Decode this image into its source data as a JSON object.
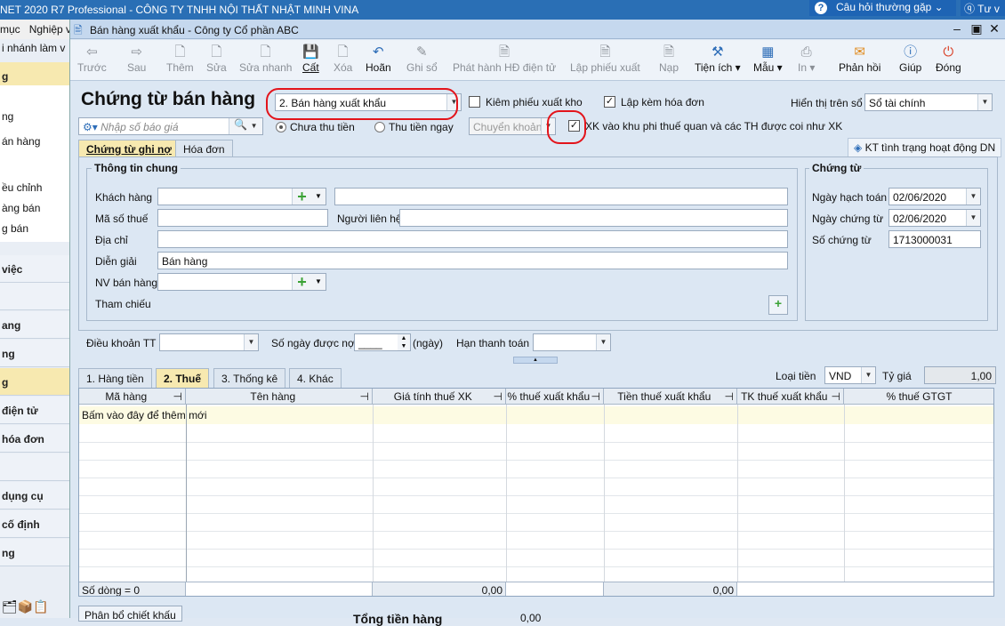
{
  "app": {
    "title": "NET 2020 R7 Professional - CÔNG TY TNHH NỘI THẤT NHẬT MINH VINA",
    "faq_label": "Câu hỏi thường gặp",
    "help_label": "Tư v",
    "menu": [
      "mục",
      "Nghiệp v"
    ]
  },
  "sidebar": {
    "items": [
      {
        "label": "i nhánh làm v",
        "kind": "text"
      },
      {
        "label": "g",
        "kind": "head"
      },
      {
        "label": "ng",
        "kind": "text"
      },
      {
        "label": "án hàng",
        "kind": "text"
      },
      {
        "label": "ều chỉnh",
        "kind": "text"
      },
      {
        "label": "àng bán",
        "kind": "text"
      },
      {
        "label": "g bán",
        "kind": "text"
      },
      {
        "label": "việc",
        "kind": "head"
      },
      {
        "label": "ang",
        "kind": "head"
      },
      {
        "label": "ng",
        "kind": "head"
      },
      {
        "label": "g",
        "kind": "head"
      },
      {
        "label": "điện tử",
        "kind": "head"
      },
      {
        "label": "hóa đơn",
        "kind": "head"
      },
      {
        "label": "dụng cụ",
        "kind": "head"
      },
      {
        "label": "cố định",
        "kind": "head"
      },
      {
        "label": "ng",
        "kind": "head"
      }
    ]
  },
  "dialog": {
    "title": "Bán hàng xuất khẩu - Công ty Cổ phần ABC"
  },
  "toolbar": {
    "items": [
      {
        "label": "Trước",
        "icon": "arrow-left-icon",
        "enabled": false
      },
      {
        "label": "Sau",
        "icon": "arrow-right-icon",
        "enabled": false
      },
      {
        "label": "Thêm",
        "icon": "new-document-icon",
        "enabled": false
      },
      {
        "label": "Sửa",
        "icon": "edit-document-icon",
        "enabled": false
      },
      {
        "label": "Sửa nhanh",
        "icon": "quick-edit-icon",
        "enabled": false
      },
      {
        "label": "Cất",
        "icon": "save-icon",
        "enabled": true
      },
      {
        "label": "Xóa",
        "icon": "delete-icon",
        "enabled": false
      },
      {
        "label": "Hoãn",
        "icon": "undo-icon",
        "enabled": true
      },
      {
        "label": "Ghi sổ",
        "icon": "pencil-icon",
        "enabled": false
      },
      {
        "label": "Phát hành HĐ điện tử",
        "icon": "e-invoice-icon",
        "enabled": false
      },
      {
        "label": "Lập phiếu xuất",
        "icon": "issue-slip-icon",
        "enabled": false
      },
      {
        "label": "Nạp",
        "icon": "load-icon",
        "enabled": false
      },
      {
        "label": "Tiện ích",
        "icon": "tools-icon",
        "enabled": true
      },
      {
        "label": "Mẫu",
        "icon": "template-icon",
        "enabled": true
      },
      {
        "label": "In",
        "icon": "print-icon",
        "enabled": false
      },
      {
        "label": "Phản hồi",
        "icon": "feedback-mail-icon",
        "enabled": true
      },
      {
        "label": "Giúp",
        "icon": "help-icon",
        "enabled": true
      },
      {
        "label": "Đóng",
        "icon": "close-power-icon",
        "enabled": true
      }
    ]
  },
  "header": {
    "title": "Chứng từ bán hàng",
    "sale_type": "2. Bán hàng xuất khẩu",
    "kiem_phieu_xuat_kho": "Kiêm phiếu xuất kho",
    "lap_kem_hoa_don": "Lập kèm hóa đơn",
    "hien_thi_label": "Hiển thị trên sổ",
    "hien_thi_value": "Sổ tài chính",
    "quote_placeholder": "Nhập số báo giá",
    "chua_thu_tien": "Chưa thu tiền",
    "thu_tien_ngay": "Thu tiền ngay",
    "payment_method": "Chuyển khoản",
    "xk_label": "XK vào khu phi thuế quan và các TH được coi như XK",
    "kt_label": "KT tình trạng hoạt động DN"
  },
  "tabs": [
    "Chứng từ ghi nợ",
    "Hóa đơn"
  ],
  "general": {
    "title": "Thông tin chung",
    "khach_hang": "Khách hàng",
    "ma_so_thue": "Mã số thuế",
    "nguoi_lien_he": "Người liên hệ",
    "dia_chi": "Địa chỉ",
    "dien_giai": "Diễn giải",
    "dien_giai_value": "Bán hàng",
    "nv_ban_hang": "NV bán hàng",
    "tham_chieu": "Tham chiếu"
  },
  "voucher": {
    "title": "Chứng từ",
    "ngay_hach_toan": "Ngày hạch toán",
    "ngay_hach_toan_value": "02/06/2020",
    "ngay_chung_tu": "Ngày chứng từ",
    "ngay_chung_tu_value": "02/06/2020",
    "so_chung_tu": "Số chứng từ",
    "so_chung_tu_value": "1713000031"
  },
  "terms": {
    "dieu_khoan": "Điều khoản TT",
    "so_ngay": "Số ngày được nợ",
    "so_ngay_value": "____",
    "ngay": "(ngày)",
    "han_thanh_toan": "Hạn thanh toán"
  },
  "detail_tabs": [
    "1. Hàng tiền",
    "2. Thuế",
    "3. Thống kê",
    "4. Khác"
  ],
  "currency": {
    "loai_tien": "Loại tiền",
    "loai_tien_value": "VND",
    "ty_gia": "Tỷ giá",
    "ty_gia_value": "1,00"
  },
  "grid": {
    "columns": [
      "Mã hàng",
      "Tên hàng",
      "Giá tính thuế XK",
      "% thuế xuất khẩu",
      "Tiền thuế xuất khẩu",
      "TK thuế xuất khẩu",
      "% thuế GTGT"
    ],
    "add_row": "Bấm vào đây để thêm mới",
    "row_count": "Số dòng = 0",
    "total_price": "0,00",
    "total_tax": "0,00"
  },
  "bottom": {
    "phan_bo": "Phân bổ chiết khấu",
    "tong_label": "Tổng tiền hàng",
    "tong_value": "0,00"
  }
}
